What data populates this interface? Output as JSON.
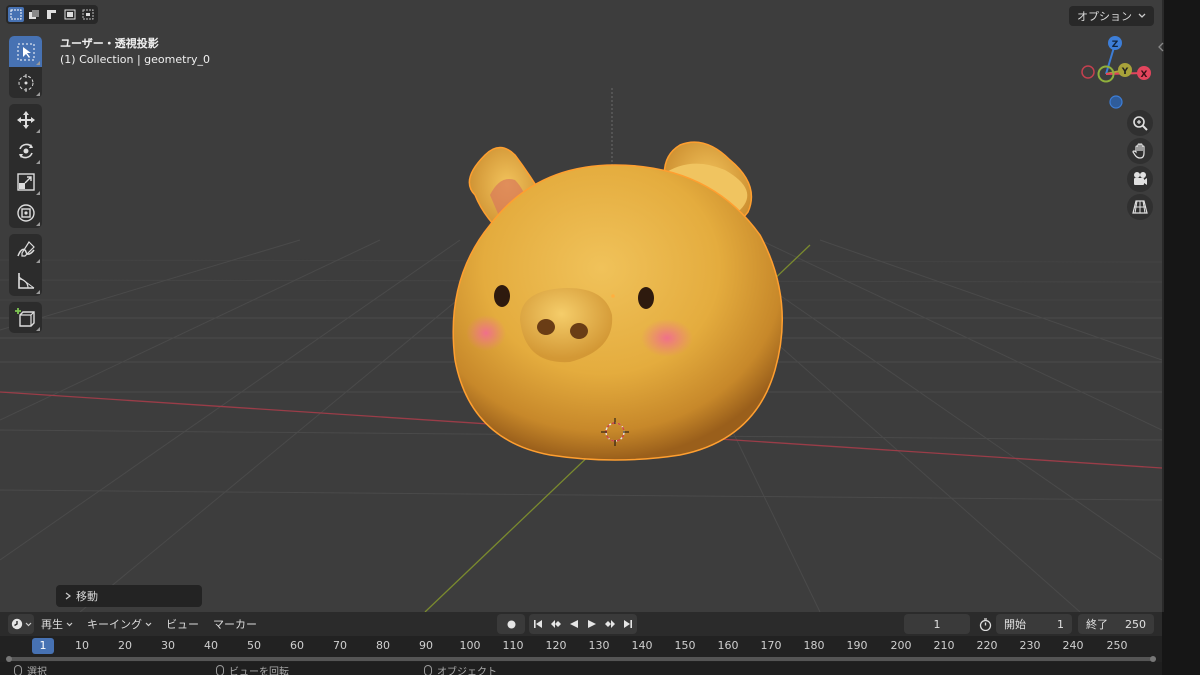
{
  "header": {
    "options_label": "オプション",
    "select_modes": [
      "select-new",
      "select-extend",
      "select-subtract",
      "select-invert",
      "select-intersect"
    ]
  },
  "view_info": {
    "title": "ユーザー・透視投影",
    "collection": "(1) Collection | geometry_0"
  },
  "toolbar": {
    "tools": [
      "select-cursor-icon",
      "cursor-icon",
      "move-icon",
      "rotate-icon",
      "scale-icon",
      "transform-icon",
      "annotate-icon",
      "measure-icon",
      "add-cube-icon"
    ]
  },
  "gizmo": {
    "axes": [
      {
        "label": "Z",
        "color": "#3d7ed8"
      },
      {
        "label": "Y",
        "color": "#7da62d"
      },
      {
        "label": "X",
        "color": "#e3455d"
      }
    ]
  },
  "nav_buttons": [
    "zoom-icon",
    "hand-pan-icon",
    "camera-icon",
    "grid-ortho-icon"
  ],
  "colors": {
    "selection_blue": "#4772b3",
    "viewport_bg": "#3d3d3d",
    "x_axis": "#c9485a",
    "y_axis": "#8fa32e",
    "object_outline": "#ff9f30"
  },
  "operator_panel": {
    "label": "移動"
  },
  "timeline": {
    "menu": {
      "playback": "再生",
      "keying": "キーイング",
      "view": "ビュー",
      "marker": "マーカー"
    },
    "current_frame": "1",
    "start_label": "開始",
    "start_value": "1",
    "end_label": "終了",
    "end_value": "250",
    "ruler_ticks": [
      "10",
      "20",
      "30",
      "40",
      "50",
      "60",
      "70",
      "80",
      "90",
      "100",
      "110",
      "120",
      "130",
      "140",
      "150",
      "160",
      "170",
      "180",
      "190",
      "200",
      "210",
      "220",
      "230",
      "240",
      "250"
    ],
    "ruler_current": "1"
  },
  "status_bar": {
    "select": "選択",
    "rotate_view": "ビューを回転",
    "object": "オブジェクト"
  }
}
